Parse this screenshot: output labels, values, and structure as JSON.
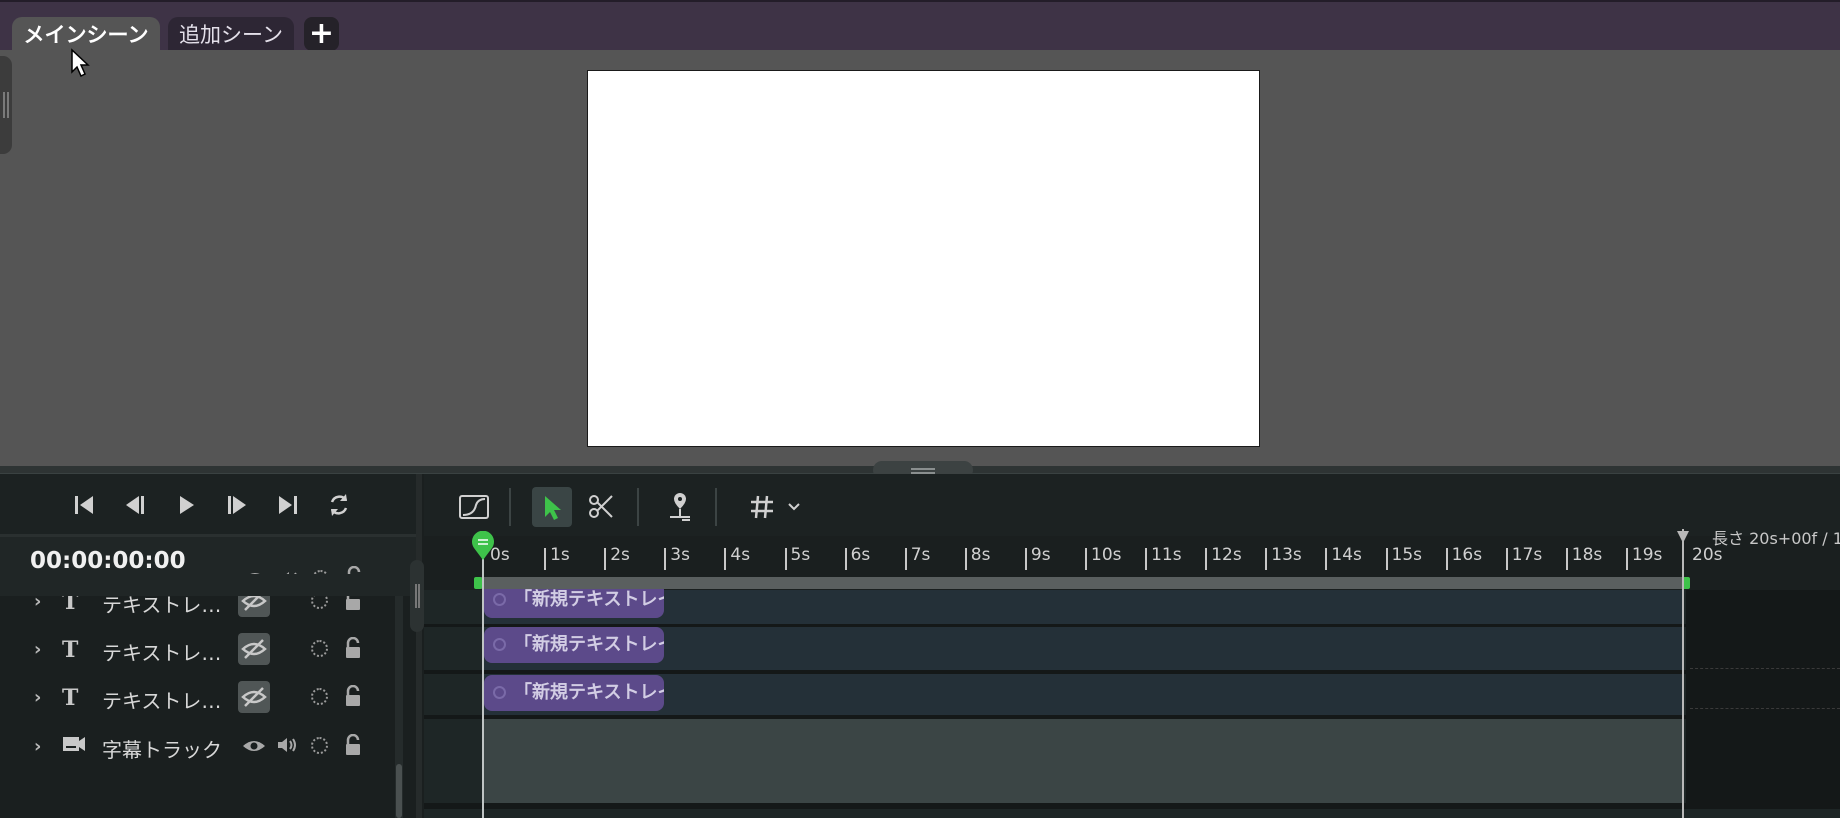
{
  "scene_tabs": [
    {
      "label": "メインシーン",
      "active": true
    },
    {
      "label": "追加シーン",
      "active": false
    }
  ],
  "add_tab_label": "+",
  "playback": {
    "timecode": "00:00:00:00",
    "buttons": [
      "skip-to-start-icon",
      "step-back-icon",
      "play-icon",
      "step-forward-icon",
      "skip-to-end-icon",
      "loop-icon"
    ]
  },
  "tracks": [
    {
      "type": "text",
      "label": "テキストレ…",
      "visible": false,
      "clip_label": "「新規テキストレイヤー」"
    },
    {
      "type": "text",
      "label": "テキストレ…",
      "visible": false,
      "clip_label": "「新規テキストレイヤー」"
    },
    {
      "type": "text",
      "label": "テキストレ…",
      "visible": false,
      "clip_label": "「新規テキストレイヤー」"
    },
    {
      "type": "subtitle",
      "label": "字幕トラック",
      "visible": true
    }
  ],
  "ruler": {
    "ticks": [
      "0s",
      "1s",
      "2s",
      "3s",
      "4s",
      "5s",
      "6s",
      "7s",
      "8s",
      "9s",
      "10s",
      "11s",
      "12s",
      "13s",
      "14s",
      "15s",
      "16s",
      "17s",
      "18s",
      "19s",
      "20s"
    ]
  },
  "length_label": "長さ  20s+00f  /  1",
  "colors": {
    "accent_green": "#3ec24a",
    "clip_purple": "#5c4a8a",
    "tab_bar": "#3e3346"
  }
}
